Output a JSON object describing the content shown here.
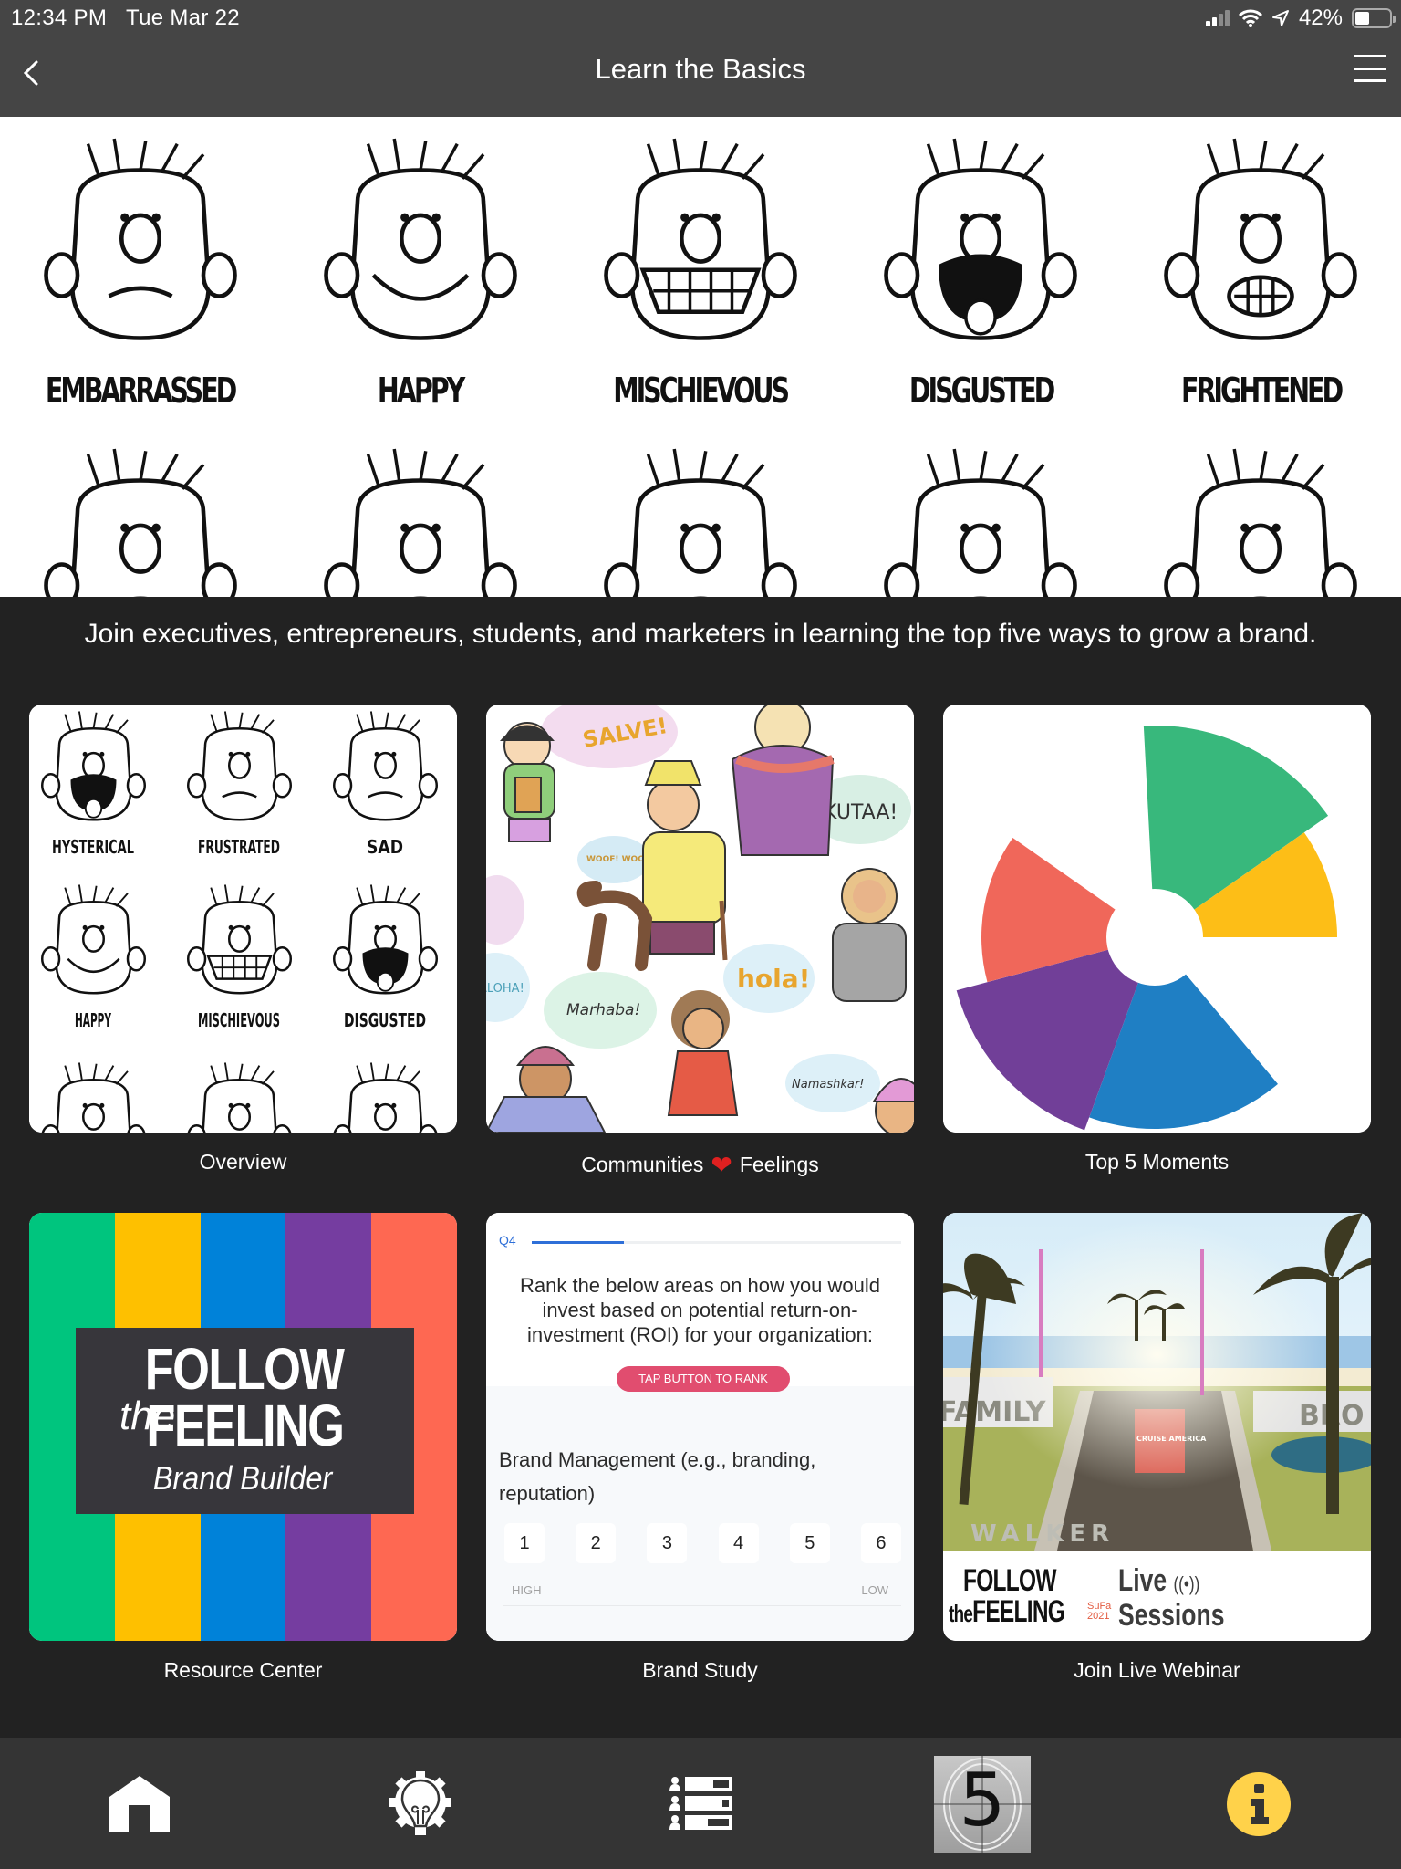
{
  "status_bar": {
    "time": "12:34 PM",
    "date": "Tue Mar 22",
    "battery_percent": "42%",
    "battery_level": 0.42,
    "icons": [
      "signal-icon",
      "wifi-icon",
      "location-arrow-icon",
      "battery-icon"
    ]
  },
  "nav": {
    "title": "Learn the Basics",
    "back_icon": "chevron-left-icon",
    "menu_icon": "hamburger-menu-icon"
  },
  "hero": {
    "faces": [
      {
        "label": "EMBARRASSED"
      },
      {
        "label": "HAPPY"
      },
      {
        "label": "MISCHIEVOUS"
      },
      {
        "label": "DISGUSTED"
      },
      {
        "label": "FRIGHTENED"
      }
    ]
  },
  "tagline": "Join executives, entrepreneurs, students, and marketers in learning the top five ways to grow a brand.",
  "tiles": [
    {
      "label": "Overview",
      "thumb_faces": [
        "HYSTERICAL",
        "FRUSTRATED",
        "SAD",
        "HAPPY",
        "MISCHIEVOUS",
        "DISGUSTED"
      ]
    },
    {
      "label_before": "Communities",
      "label_emoji": "❤️",
      "label_after": "Feelings",
      "speech_bubbles": [
        "SALVE!",
        "KUTAA!",
        "WOOF! WOOF!",
        "hola!",
        "Marhaba!",
        "Namashkar!",
        "ALOHA!"
      ]
    },
    {
      "label": "Top 5 Moments",
      "logo_colors": {
        "green": "#38b87c",
        "yellow": "#fdbe17",
        "blue": "#1f7fc4",
        "purple": "#713f98",
        "red": "#f0675a",
        "gray": "#505050"
      }
    },
    {
      "label": "Resource Center",
      "follow": "FOLLOW",
      "the": "the",
      "feeling": "FEELING",
      "subtitle": "Brand Builder",
      "stripe_colors": [
        "#00c57e",
        "#fec000",
        "#0082d9",
        "#753da0",
        "#fe6852"
      ]
    },
    {
      "label": "Brand Study",
      "question_number": "Q4",
      "progress": 0.25,
      "question": "Rank the below areas on how you would invest based on potential return-on-investment (ROI) for your organization:",
      "rank_button": "TAP BUTTON TO RANK",
      "item": "Brand Management (e.g., branding, reputation)",
      "ranks": [
        "1",
        "2",
        "3",
        "4",
        "5",
        "6"
      ],
      "high_label": "HIGH",
      "low_label": "LOW"
    },
    {
      "label": "Join Live Webinar",
      "footer_follow": "FOLLOW",
      "footer_feeling": "FEELING",
      "footer_the": "the",
      "footer_live": "Live",
      "footer_sessions": "Sessions",
      "footer_sufa": "SuFa",
      "footer_year": "2021",
      "scene_signs": [
        "FAMILY",
        "WALKER",
        "CRUISE AMERICA",
        "BRO"
      ]
    }
  ],
  "tabbar": [
    {
      "name": "home",
      "icon": "home-icon"
    },
    {
      "name": "ideas",
      "icon": "lightbulb-gear-icon"
    },
    {
      "name": "list",
      "icon": "people-list-icon"
    },
    {
      "name": "top-5",
      "icon": "countdown-5-icon",
      "text": "5"
    },
    {
      "name": "info",
      "icon": "info-icon",
      "color": "#ffd24a"
    }
  ]
}
